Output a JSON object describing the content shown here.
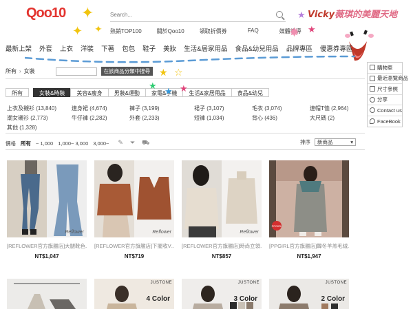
{
  "header": {
    "logo": "Qoo10",
    "search_placeholder": "Search...",
    "top_links": [
      "熱銷TOP100",
      "關於Qoo10",
      "領取折價券",
      "FAQ",
      "媒體報導"
    ],
    "blog_title_name": "Vicky",
    "blog_title_rest": "薇琪的美麗天地"
  },
  "main_nav": [
    "最新上架",
    "外套",
    "上衣",
    "洋裝",
    "下著",
    "包包",
    "鞋子",
    "美妝",
    "生活&居家用品",
    "食品&幼兒用品",
    "品牌專區",
    "優惠券專區"
  ],
  "breadcrumb": {
    "root": "所有",
    "current": "女裝",
    "search_button": "在該商品分類中搜尋"
  },
  "tabs": [
    "所有",
    "女裝&時裝",
    "美容&瘦身",
    "男裝&運動",
    "家電&手機",
    "生活&家居用品",
    "食品&幼兒"
  ],
  "active_tab_index": 1,
  "subcategories": [
    "上衣及襯衫 (13,840)",
    "連身裙 (4,674)",
    "褲子 (3,199)",
    "裙子 (3,107)",
    "毛衣 (3,074)",
    "連帽T恤 (2,964)",
    "潮女襯衫 (2,773)",
    "牛仔褲 (2,282)",
    "外套 (2,233)",
    "短褲 (1,034)",
    "背心 (436)",
    "大尺碼 (2)",
    "其他 (1,328)"
  ],
  "filter": {
    "price_label": "價格",
    "options": [
      "所有",
      "~ 1,000",
      "1,000~ 3,000",
      "3,000~"
    ],
    "sort_label": "排序",
    "sort_value": "新商品"
  },
  "sidebar": [
    "購物車",
    "最近瀏覽商品",
    "尺寸參照",
    "分享",
    "Contact us",
    "FaceBook"
  ],
  "products": [
    {
      "name": "[REFLOWER官方旗艦店]大腿靴色...",
      "price": "NT$1,047",
      "badge": "Reflower"
    },
    {
      "name": "[REFLOWER官方旗艦店]下擺收V...",
      "price": "NT$719",
      "badge": "Reflower"
    },
    {
      "name": "[REFLOWER官方旗艦店]時尚立領...",
      "price": "NT$857",
      "badge": "Reflower"
    },
    {
      "name": "[PPGIRL官方旗艦店]韓冬羊羔毛絨...",
      "price": "NT$1,947",
      "badge": "PPGIRL"
    }
  ],
  "products_row2": [
    {
      "brand": "",
      "color_label": ""
    },
    {
      "brand": "JUSTONE",
      "color_label": "4 Color"
    },
    {
      "brand": "JUSTONE",
      "color_label": "3 Color"
    },
    {
      "brand": "JUSTONE",
      "color_label": "2 Color"
    }
  ],
  "colors": {
    "logo_red": "#e3342f",
    "active_tab": "#333333",
    "blog_title": "#e06a85"
  }
}
